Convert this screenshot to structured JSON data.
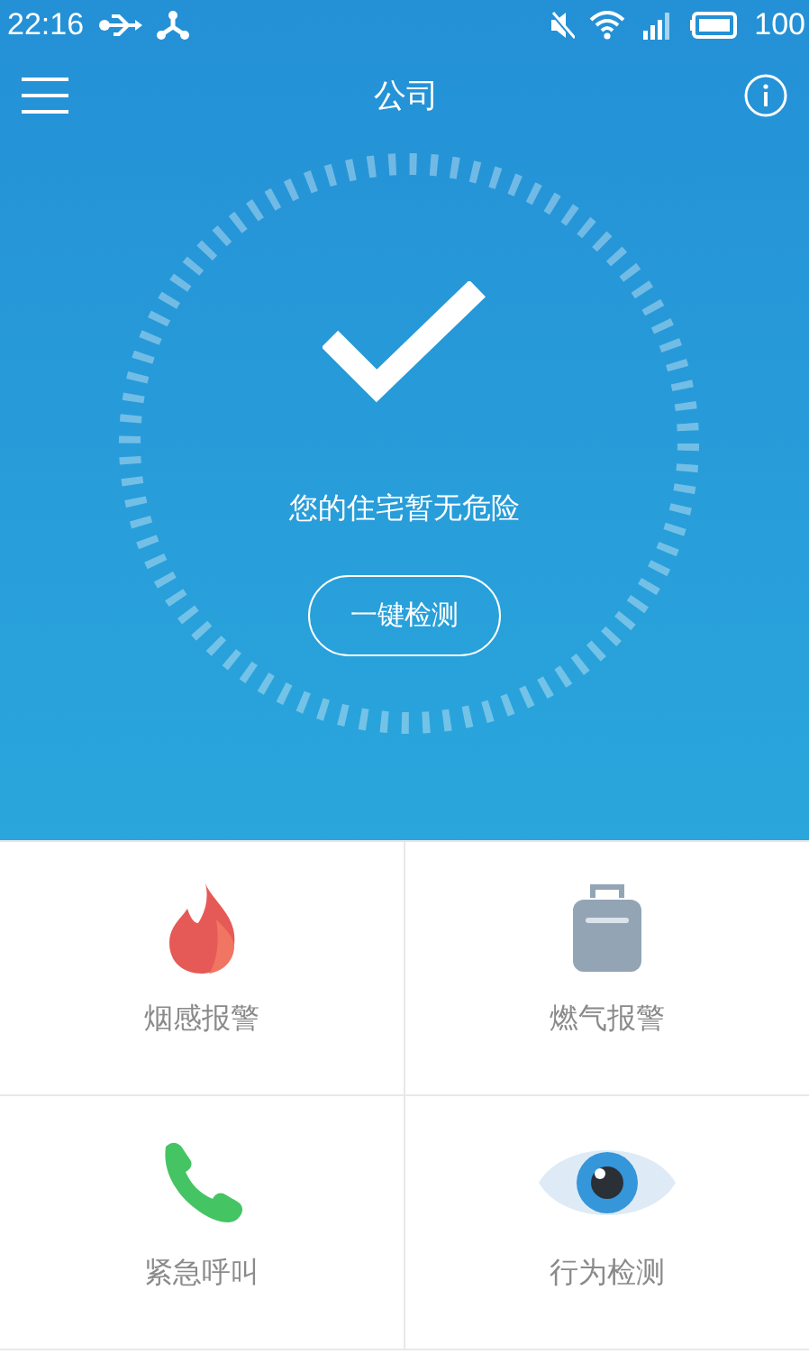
{
  "status_bar": {
    "time": "22:16",
    "battery_text": "100"
  },
  "header": {
    "title": "公司"
  },
  "hero": {
    "message": "您的住宅暂无危险",
    "button": "一键检测"
  },
  "tiles": [
    {
      "kind": "fire",
      "label": "烟感报警"
    },
    {
      "kind": "gas",
      "label": "燃气报警"
    },
    {
      "kind": "phone",
      "label": "紧急呼叫"
    },
    {
      "kind": "eye",
      "label": "行为检测"
    }
  ]
}
